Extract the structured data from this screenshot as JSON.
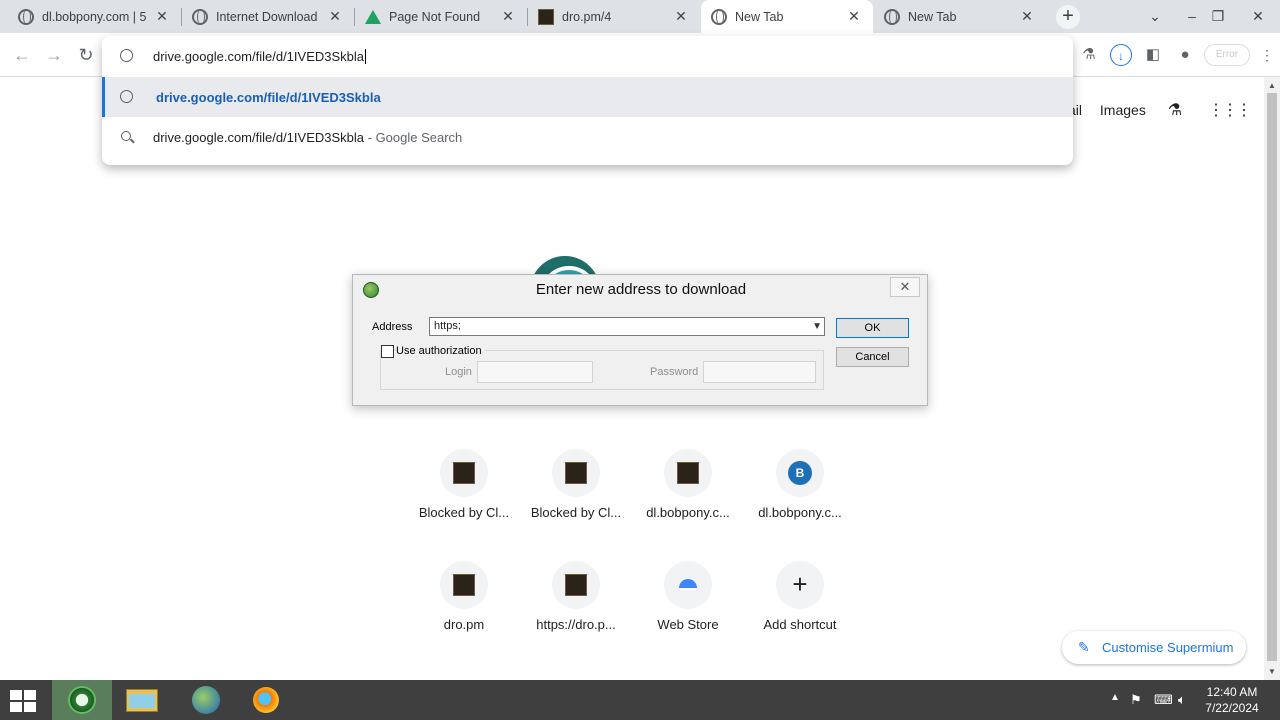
{
  "tabs": [
    {
      "title": "dl.bobpony.com | 5",
      "icon": "globe-icon"
    },
    {
      "title": "Internet Download",
      "icon": "globe-icon"
    },
    {
      "title": "Page Not Found",
      "icon": "google-drive-icon"
    },
    {
      "title": "dro.pm/4",
      "icon": "site-thumbnail-icon"
    },
    {
      "title": "New Tab",
      "icon": "globe-icon"
    },
    {
      "title": "New Tab",
      "icon": "globe-icon"
    }
  ],
  "toolbar": {
    "omnibox_text": "drive.google.com/file/d/1IVED3Skbla",
    "error_label": "Error"
  },
  "omnibox": {
    "suggestions": [
      {
        "text": "drive.google.com/file/d/1IVED3Skbla",
        "suffix": ""
      },
      {
        "text": "drive.google.com/file/d/1IVED3Skbla",
        "suffix": " - Google Search"
      }
    ]
  },
  "newtab": {
    "links": {
      "mail": "ail",
      "images": "Images"
    },
    "shortcuts": [
      {
        "label": "Blocked by Cl...",
        "kind": "thumb"
      },
      {
        "label": "Blocked by Cl...",
        "kind": "thumb"
      },
      {
        "label": "dl.bobpony.c...",
        "kind": "thumb"
      },
      {
        "label": "dl.bobpony.c...",
        "kind": "letter",
        "letter": "B"
      },
      {
        "label": "dro.pm",
        "kind": "thumb"
      },
      {
        "label": "https://dro.p...",
        "kind": "thumb"
      },
      {
        "label": "Web Store",
        "kind": "webstore"
      },
      {
        "label": "Add shortcut",
        "kind": "add"
      }
    ],
    "customise_label": "Customise Supermium"
  },
  "dialog": {
    "title": "Enter new address to download",
    "address_label": "Address",
    "address_value": "https;",
    "use_auth_label": "Use authorization",
    "login_label": "Login",
    "password_label": "Password",
    "ok_label": "OK",
    "cancel_label": "Cancel",
    "use_auth_checked": false
  },
  "taskbar": {
    "time": "12:40 AM",
    "date": "7/22/2024"
  }
}
